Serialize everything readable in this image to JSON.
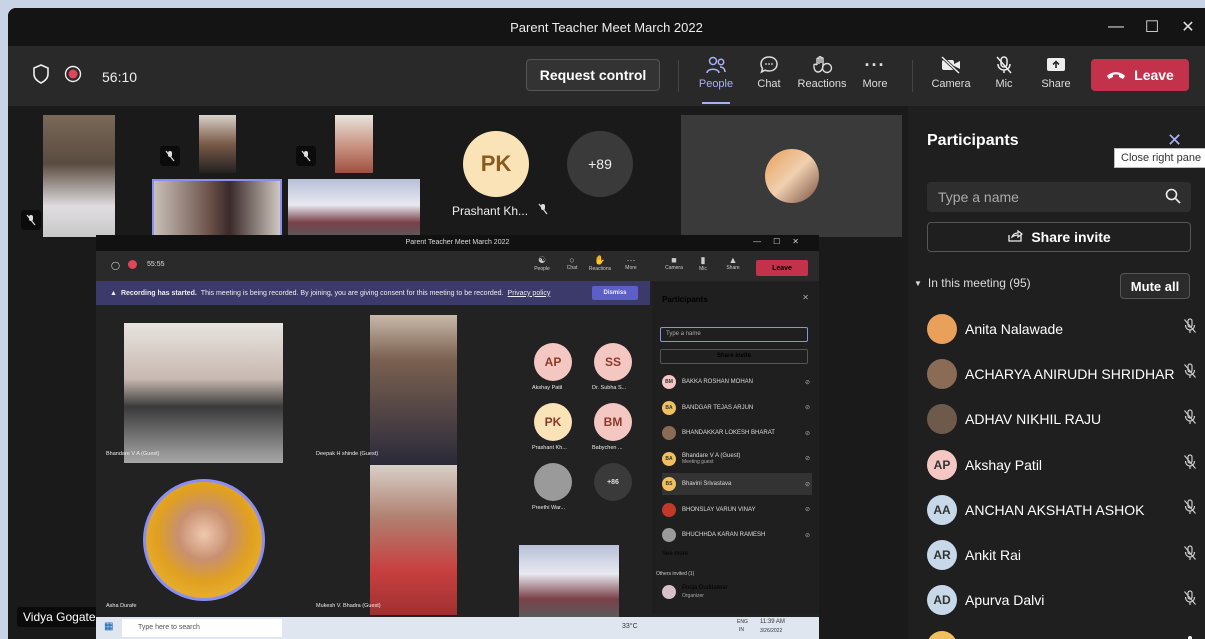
{
  "window": {
    "title": "Parent Teacher Meet March 2022"
  },
  "toolbar": {
    "timer": "56:10",
    "request_control": "Request control",
    "people": "People",
    "chat": "Chat",
    "reactions": "Reactions",
    "more": "More",
    "camera": "Camera",
    "mic": "Mic",
    "share": "Share",
    "leave": "Leave"
  },
  "stage": {
    "pk_initials": "PK",
    "pk_name": "Prashant Kh...",
    "overflow_count": "+89",
    "speaker_name": "Vidya Gogate"
  },
  "panel": {
    "title": "Participants",
    "close_tooltip": "Close right pane",
    "search_placeholder": "Type a name",
    "share_invite": "Share invite",
    "section_label": "In this meeting (95)",
    "mute_all": "Mute all",
    "participants": [
      {
        "name": "Anita Nalawade",
        "initials": "",
        "color": "#e8a05a",
        "mic": "muted"
      },
      {
        "name": "ACHARYA ANIRUDH SHRIDHAR",
        "initials": "",
        "color": "#8a6b55",
        "mic": "muted"
      },
      {
        "name": "ADHAV NIKHIL RAJU",
        "initials": "",
        "color": "#6e5a4a",
        "mic": "muted"
      },
      {
        "name": "Akshay Patil",
        "initials": "AP",
        "color": "#f4c7c3",
        "mic": "muted"
      },
      {
        "name": "ANCHAN AKSHATH ASHOK",
        "initials": "AA",
        "color": "#c7d8e8",
        "mic": "muted"
      },
      {
        "name": "Ankit Rai",
        "initials": "AR",
        "color": "#c7d8e8",
        "mic": "muted"
      },
      {
        "name": "Apurva Dalvi",
        "initials": "AD",
        "color": "#c7d8e8",
        "mic": "muted"
      },
      {
        "name": "Asha Durafe",
        "initials": "",
        "color": "#f0c060",
        "mic": "on"
      }
    ]
  },
  "inner": {
    "title": "Parent Teacher Meet March 2022",
    "timer": "55:55",
    "people": "People",
    "chat": "Chat",
    "reactions": "Reactions",
    "more": "More",
    "camera": "Camera",
    "mic": "Mic",
    "share": "Share",
    "leave": "Leave",
    "recording_bold": "Recording has started.",
    "recording_text": "This meeting is being recorded. By joining, you are giving consent for this meeting to be recorded.",
    "privacy": "Privacy policy",
    "dismiss": "Dismiss",
    "tile_labels": [
      "Bhandare V A (Guest)",
      "Deepak H shinde (Guest)",
      "Asha Durafe",
      "Mukesh V. Bhadra (Guest)"
    ],
    "avatars": [
      {
        "initials": "AP",
        "name": "Akshay Patil"
      },
      {
        "initials": "SS",
        "name": "Dr. Subha S..."
      },
      {
        "initials": "PK",
        "name": "Prashant Kh..."
      },
      {
        "initials": "BM",
        "name": "Babychen ..."
      },
      {
        "initials": "",
        "name": "Preethi War..."
      },
      {
        "initials": "+86",
        "name": ""
      }
    ],
    "panel_title": "Participants",
    "search_placeholder": "Type a name",
    "share_invite": "Share invite",
    "list": [
      {
        "initials": "BM",
        "name": "BAKKA ROSHAN MOHAN",
        "sub": ""
      },
      {
        "initials": "BA",
        "name": "BANDGAR TEJAS ARJUN",
        "sub": ""
      },
      {
        "initials": "",
        "name": "BHANDAKKAR LOKESH BHARAT",
        "sub": ""
      },
      {
        "initials": "BA",
        "name": "Bhandare V A (Guest)",
        "sub": "Meeting guest"
      },
      {
        "initials": "BS",
        "name": "Bhavini Srivastava",
        "sub": ""
      },
      {
        "initials": "",
        "name": "BHONSLAY VARUN VINAY",
        "sub": ""
      },
      {
        "initials": "",
        "name": "BHUCHHDA KARAN RAMESH",
        "sub": ""
      }
    ],
    "see_more": "See more",
    "others_invited": "Others invited (1)",
    "organizer_name": "Pooja Duddalwar",
    "organizer_role": "Organizer"
  },
  "taskbar": {
    "search": "Type here to search",
    "weather": "33°C",
    "lang": "ENG",
    "region": "IN",
    "time": "11:39 AM",
    "date": "3/26/2022"
  }
}
